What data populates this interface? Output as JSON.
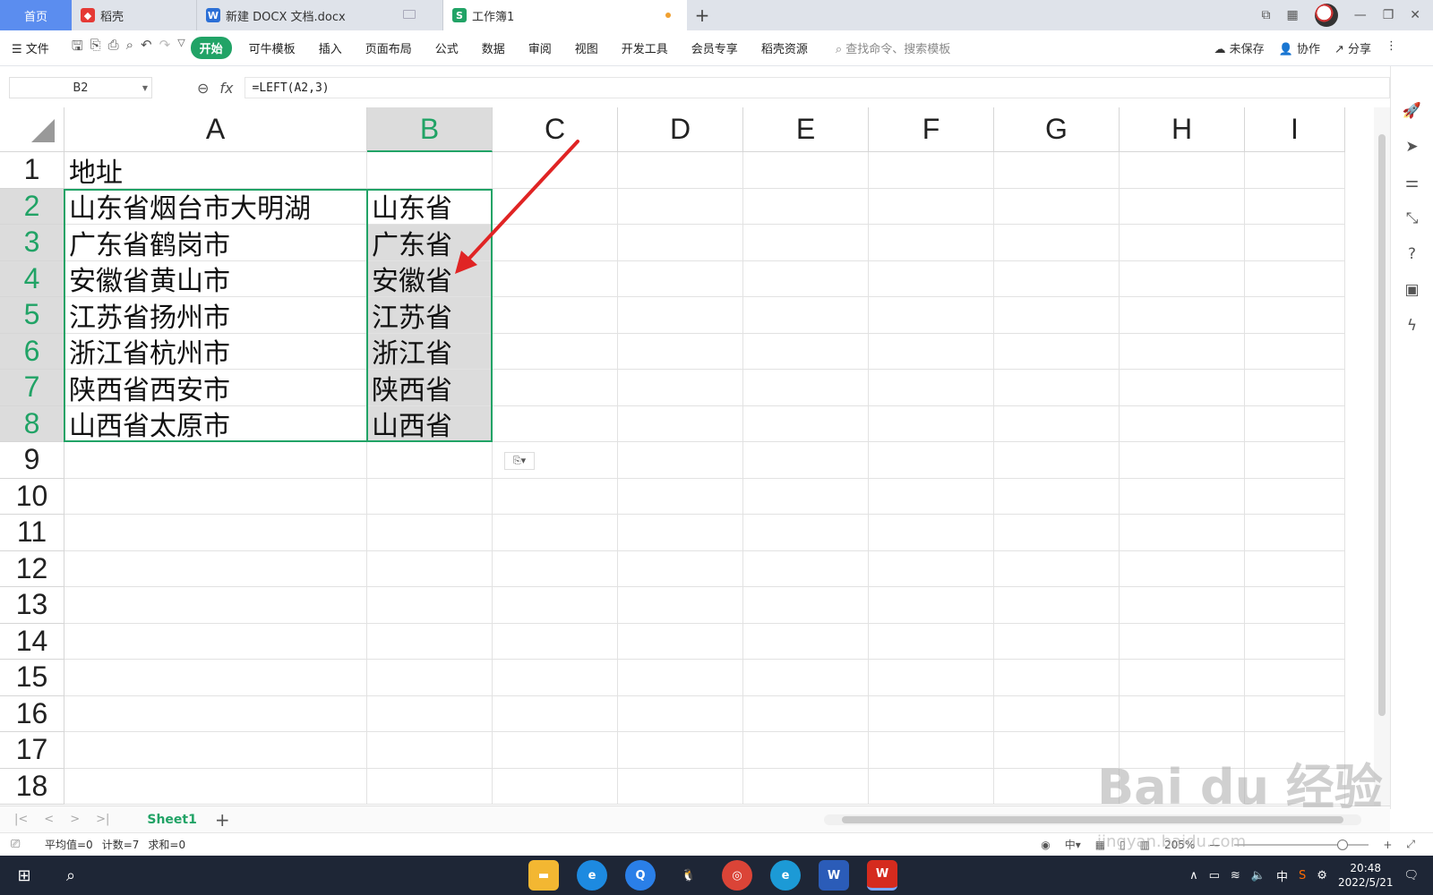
{
  "tabs": {
    "home": "首页",
    "daoke": "稻壳",
    "docx": "新建 DOCX 文档.docx",
    "workbook": "工作簿1"
  },
  "ribbon": {
    "menu": "文件",
    "start": "开始",
    "items": [
      "可牛模板",
      "插入",
      "页面布局",
      "公式",
      "数据",
      "审阅",
      "视图",
      "开发工具",
      "会员专享",
      "稻壳资源"
    ],
    "search_placeholder": "查找命令、搜索模板",
    "unsaved": "未保存",
    "collab": "协作",
    "share": "分享"
  },
  "formula_bar": {
    "name_box": "B2",
    "fx": "fx",
    "formula": "=LEFT(A2,3)"
  },
  "columns": [
    "A",
    "B",
    "C",
    "D",
    "E",
    "F",
    "G",
    "H",
    "I"
  ],
  "rows": [
    "1",
    "2",
    "3",
    "4",
    "5",
    "6",
    "7",
    "8",
    "9",
    "10",
    "11",
    "12",
    "13",
    "14",
    "15",
    "16",
    "17",
    "18"
  ],
  "cells": {
    "A1": "地址",
    "A2": "山东省烟台市大明湖",
    "A3": "广东省鹤岗市",
    "A4": "安徽省黄山市",
    "A5": "江苏省扬州市",
    "A6": "浙江省杭州市",
    "A7": "陕西省西安市",
    "A8": "山西省太原市",
    "B2": "山东省",
    "B3": "广东省",
    "B4": "安徽省",
    "B5": "江苏省",
    "B6": "浙江省",
    "B7": "陕西省",
    "B8": "山西省"
  },
  "sheet": {
    "name": "Sheet1"
  },
  "status": {
    "avg": "平均值=0",
    "count": "计数=7",
    "sum": "求和=0",
    "zoom": "205%"
  },
  "taskbar": {
    "time": "20:48",
    "date": "2022/5/21",
    "ime": "中"
  },
  "watermark": {
    "brand": "Bai du 经验",
    "url": "jingyan.baidu.com"
  },
  "colors": {
    "accent": "#21a366",
    "selection_bg": "#dcdcdc",
    "arrow": "#e02424"
  }
}
